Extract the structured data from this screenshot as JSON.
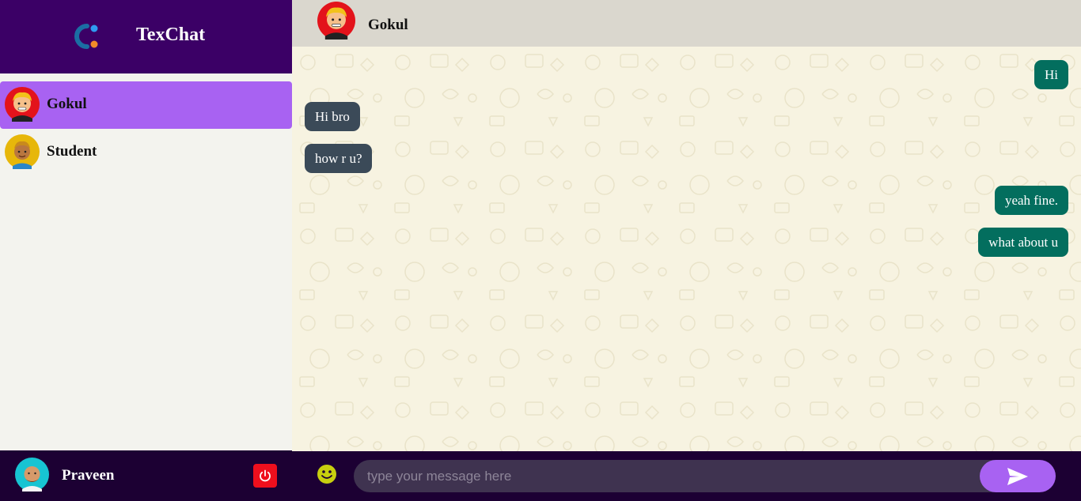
{
  "brand": {
    "title": "TexChat",
    "logo_icon": "texchat-logo-icon",
    "bg": "#3b0066"
  },
  "contacts": [
    {
      "name": "Gokul",
      "active": true,
      "avatar_icon": "gokul-avatar-icon"
    },
    {
      "name": "Student",
      "active": false,
      "avatar_icon": "student-avatar-icon"
    }
  ],
  "current_user": {
    "name": "Praveen",
    "avatar_icon": "praveen-avatar-icon",
    "logout_icon": "power-icon"
  },
  "chat": {
    "header": {
      "name": "Gokul",
      "avatar_icon": "gokul-avatar-icon"
    },
    "messages": [
      {
        "text": "Hi",
        "direction": "out"
      },
      {
        "text": "Hi bro",
        "direction": "in"
      },
      {
        "text": "how r u?",
        "direction": "in"
      },
      {
        "text": "yeah fine.",
        "direction": "out"
      },
      {
        "text": "what about u",
        "direction": "out"
      }
    ],
    "composer": {
      "placeholder": "type your message here",
      "value": "",
      "emoji_icon": "smiley-icon",
      "send_icon": "send-icon"
    }
  },
  "colors": {
    "accent": "#a862f2",
    "outgoing": "#036e5e",
    "incoming": "#3b4a58",
    "logout": "#ee0f1d",
    "dark": "#1c0033"
  }
}
